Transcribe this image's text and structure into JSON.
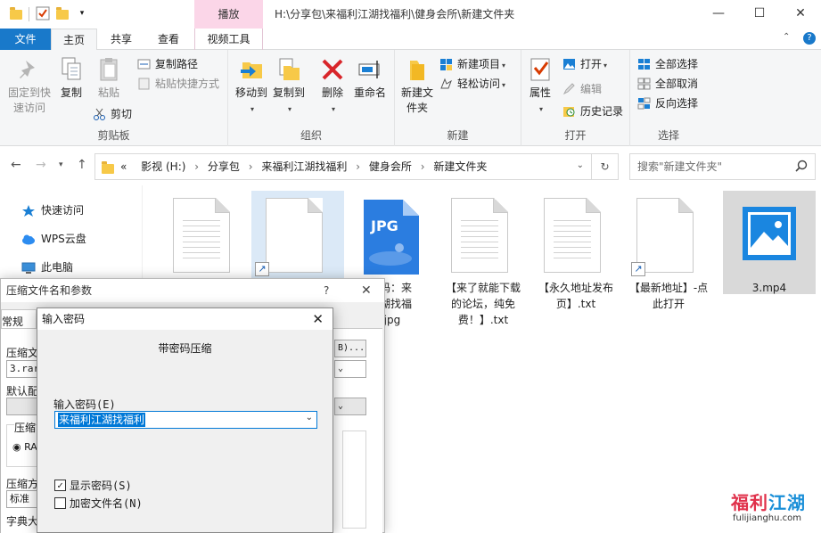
{
  "window": {
    "context_tab": "播放",
    "title": "H:\\分享包\\来福利江湖找福利\\健身会所\\新建文件夹",
    "minimize": "—",
    "maximize": "☐",
    "close": "✕"
  },
  "tabs": {
    "file": "文件",
    "home": "主页",
    "share": "共享",
    "view": "查看",
    "video_tools": "视频工具"
  },
  "ribbon": {
    "clipboard": {
      "pin_quick_access": "固定到快速访问",
      "copy": "复制",
      "paste": "粘贴",
      "copy_path": "复制路径",
      "paste_shortcut": "粘贴快捷方式",
      "cut": "剪切",
      "label": "剪贴板"
    },
    "organize": {
      "move_to": "移动到",
      "copy_to": "复制到",
      "delete": "删除",
      "rename": "重命名",
      "label": "组织"
    },
    "new": {
      "new_folder": "新建文件夹",
      "new_item": "新建项目",
      "easy_access": "轻松访问",
      "label": "新建"
    },
    "open": {
      "properties": "属性",
      "open": "打开",
      "edit": "编辑",
      "history": "历史记录",
      "label": "打开"
    },
    "select": {
      "select_all": "全部选择",
      "select_none": "全部取消",
      "invert": "反向选择",
      "label": "选择"
    }
  },
  "address": {
    "overflow": "«",
    "path": [
      "影视 (H:)",
      "分享包",
      "来福利江湖找福利",
      "健身会所",
      "新建文件夹"
    ],
    "search_placeholder": "搜索\"新建文件夹\""
  },
  "nav": {
    "items": [
      "快速访问",
      "WPS云盘",
      "此电脑"
    ]
  },
  "files": [
    {
      "label": "",
      "type": "doc"
    },
    {
      "label": "",
      "type": "doc-shortcut"
    },
    {
      "label": "密码：来\n江湖找福\n.jpg",
      "type": "jpg",
      "badge": "JPG"
    },
    {
      "label": "【来了就能下载\n的论坛，纯免\n费！】.txt",
      "type": "doc"
    },
    {
      "label": "【永久地址发布\n页】.txt",
      "type": "doc"
    },
    {
      "label": "【最新地址】-点\n此打开",
      "type": "doc-shortcut"
    },
    {
      "label": "3.mp4",
      "type": "mp4"
    }
  ],
  "archive_dialog": {
    "title": "压缩文件名和参数",
    "help": "?",
    "close": "✕",
    "tab_general": "常规",
    "label_filename": "压缩文",
    "filename_value": "3.rar",
    "browse": "B)...",
    "label_profile": "默认配",
    "label_format": "压缩",
    "format_rar": "RA",
    "label_method": "压缩方",
    "method_value": "标准",
    "label_dict": "字典大"
  },
  "password_dialog": {
    "title": "输入密码",
    "close": "✕",
    "heading": "带密码压缩",
    "label": "输入密码(E)",
    "value": "来福利江湖找福利",
    "show_password": "显示密码(S)",
    "show_password_checked": true,
    "encrypt_names": "加密文件名(N)",
    "encrypt_names_checked": false
  },
  "watermark": {
    "text_a": "福利",
    "text_b": "江湖",
    "url": "fulijianghu.com"
  },
  "colors": {
    "accent": "#1979ca",
    "context_tab": "#fbd6e8",
    "selection": "#0078d7"
  }
}
